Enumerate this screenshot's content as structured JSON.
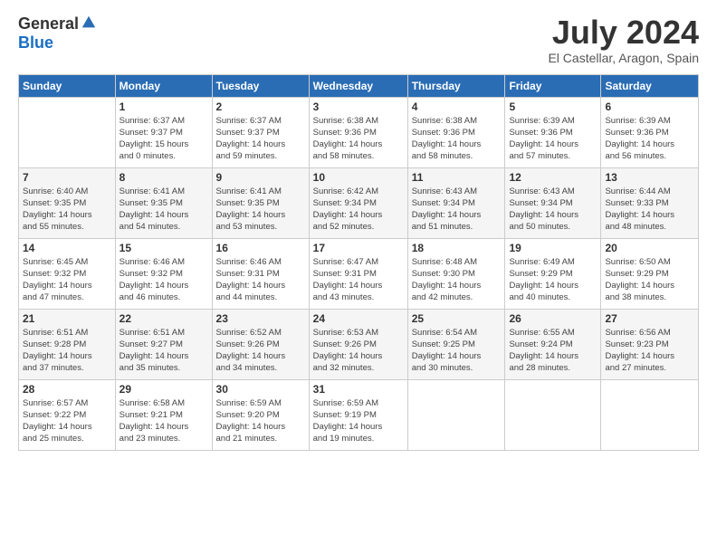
{
  "logo": {
    "general": "General",
    "blue": "Blue"
  },
  "header": {
    "month": "July 2024",
    "location": "El Castellar, Aragon, Spain"
  },
  "weekdays": [
    "Sunday",
    "Monday",
    "Tuesday",
    "Wednesday",
    "Thursday",
    "Friday",
    "Saturday"
  ],
  "weeks": [
    [
      {
        "day": "",
        "info": ""
      },
      {
        "day": "1",
        "info": "Sunrise: 6:37 AM\nSunset: 9:37 PM\nDaylight: 15 hours\nand 0 minutes."
      },
      {
        "day": "2",
        "info": "Sunrise: 6:37 AM\nSunset: 9:37 PM\nDaylight: 14 hours\nand 59 minutes."
      },
      {
        "day": "3",
        "info": "Sunrise: 6:38 AM\nSunset: 9:36 PM\nDaylight: 14 hours\nand 58 minutes."
      },
      {
        "day": "4",
        "info": "Sunrise: 6:38 AM\nSunset: 9:36 PM\nDaylight: 14 hours\nand 58 minutes."
      },
      {
        "day": "5",
        "info": "Sunrise: 6:39 AM\nSunset: 9:36 PM\nDaylight: 14 hours\nand 57 minutes."
      },
      {
        "day": "6",
        "info": "Sunrise: 6:39 AM\nSunset: 9:36 PM\nDaylight: 14 hours\nand 56 minutes."
      }
    ],
    [
      {
        "day": "7",
        "info": "Sunrise: 6:40 AM\nSunset: 9:35 PM\nDaylight: 14 hours\nand 55 minutes."
      },
      {
        "day": "8",
        "info": "Sunrise: 6:41 AM\nSunset: 9:35 PM\nDaylight: 14 hours\nand 54 minutes."
      },
      {
        "day": "9",
        "info": "Sunrise: 6:41 AM\nSunset: 9:35 PM\nDaylight: 14 hours\nand 53 minutes."
      },
      {
        "day": "10",
        "info": "Sunrise: 6:42 AM\nSunset: 9:34 PM\nDaylight: 14 hours\nand 52 minutes."
      },
      {
        "day": "11",
        "info": "Sunrise: 6:43 AM\nSunset: 9:34 PM\nDaylight: 14 hours\nand 51 minutes."
      },
      {
        "day": "12",
        "info": "Sunrise: 6:43 AM\nSunset: 9:34 PM\nDaylight: 14 hours\nand 50 minutes."
      },
      {
        "day": "13",
        "info": "Sunrise: 6:44 AM\nSunset: 9:33 PM\nDaylight: 14 hours\nand 48 minutes."
      }
    ],
    [
      {
        "day": "14",
        "info": "Sunrise: 6:45 AM\nSunset: 9:32 PM\nDaylight: 14 hours\nand 47 minutes."
      },
      {
        "day": "15",
        "info": "Sunrise: 6:46 AM\nSunset: 9:32 PM\nDaylight: 14 hours\nand 46 minutes."
      },
      {
        "day": "16",
        "info": "Sunrise: 6:46 AM\nSunset: 9:31 PM\nDaylight: 14 hours\nand 44 minutes."
      },
      {
        "day": "17",
        "info": "Sunrise: 6:47 AM\nSunset: 9:31 PM\nDaylight: 14 hours\nand 43 minutes."
      },
      {
        "day": "18",
        "info": "Sunrise: 6:48 AM\nSunset: 9:30 PM\nDaylight: 14 hours\nand 42 minutes."
      },
      {
        "day": "19",
        "info": "Sunrise: 6:49 AM\nSunset: 9:29 PM\nDaylight: 14 hours\nand 40 minutes."
      },
      {
        "day": "20",
        "info": "Sunrise: 6:50 AM\nSunset: 9:29 PM\nDaylight: 14 hours\nand 38 minutes."
      }
    ],
    [
      {
        "day": "21",
        "info": "Sunrise: 6:51 AM\nSunset: 9:28 PM\nDaylight: 14 hours\nand 37 minutes."
      },
      {
        "day": "22",
        "info": "Sunrise: 6:51 AM\nSunset: 9:27 PM\nDaylight: 14 hours\nand 35 minutes."
      },
      {
        "day": "23",
        "info": "Sunrise: 6:52 AM\nSunset: 9:26 PM\nDaylight: 14 hours\nand 34 minutes."
      },
      {
        "day": "24",
        "info": "Sunrise: 6:53 AM\nSunset: 9:26 PM\nDaylight: 14 hours\nand 32 minutes."
      },
      {
        "day": "25",
        "info": "Sunrise: 6:54 AM\nSunset: 9:25 PM\nDaylight: 14 hours\nand 30 minutes."
      },
      {
        "day": "26",
        "info": "Sunrise: 6:55 AM\nSunset: 9:24 PM\nDaylight: 14 hours\nand 28 minutes."
      },
      {
        "day": "27",
        "info": "Sunrise: 6:56 AM\nSunset: 9:23 PM\nDaylight: 14 hours\nand 27 minutes."
      }
    ],
    [
      {
        "day": "28",
        "info": "Sunrise: 6:57 AM\nSunset: 9:22 PM\nDaylight: 14 hours\nand 25 minutes."
      },
      {
        "day": "29",
        "info": "Sunrise: 6:58 AM\nSunset: 9:21 PM\nDaylight: 14 hours\nand 23 minutes."
      },
      {
        "day": "30",
        "info": "Sunrise: 6:59 AM\nSunset: 9:20 PM\nDaylight: 14 hours\nand 21 minutes."
      },
      {
        "day": "31",
        "info": "Sunrise: 6:59 AM\nSunset: 9:19 PM\nDaylight: 14 hours\nand 19 minutes."
      },
      {
        "day": "",
        "info": ""
      },
      {
        "day": "",
        "info": ""
      },
      {
        "day": "",
        "info": ""
      }
    ]
  ]
}
